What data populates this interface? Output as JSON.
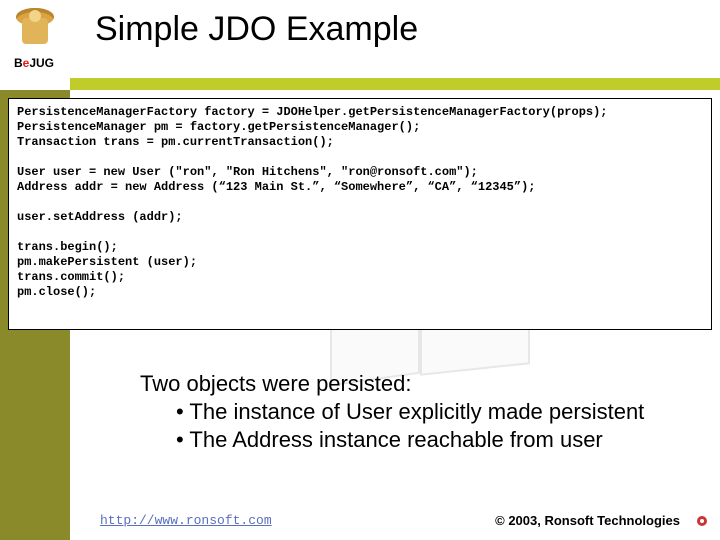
{
  "title": "Simple JDO Example",
  "logo_text_parts": {
    "b": "B",
    "e": "e",
    "jug": "JUG"
  },
  "code": "PersistenceManagerFactory factory = JDOHelper.getPersistenceManagerFactory(props);\nPersistenceManager pm = factory.getPersistenceManager();\nTransaction trans = pm.currentTransaction();\n\nUser user = new User (\"ron\", \"Ron Hitchens\", \"ron@ronsoft.com\");\nAddress addr = new Address (“123 Main St.”, “Somewhere”, “CA”, “12345”);\n\nuser.setAddress (addr);\n\ntrans.begin();\npm.makePersistent (user);\ntrans.commit();\npm.close();",
  "body": {
    "heading": "Two objects were persisted:",
    "bullets": [
      "The instance of User explicitly made persistent",
      "The Address instance reachable from user"
    ]
  },
  "footer": {
    "url": "http://www.ronsoft.com",
    "copyright": "© 2003, Ronsoft Technologies"
  }
}
